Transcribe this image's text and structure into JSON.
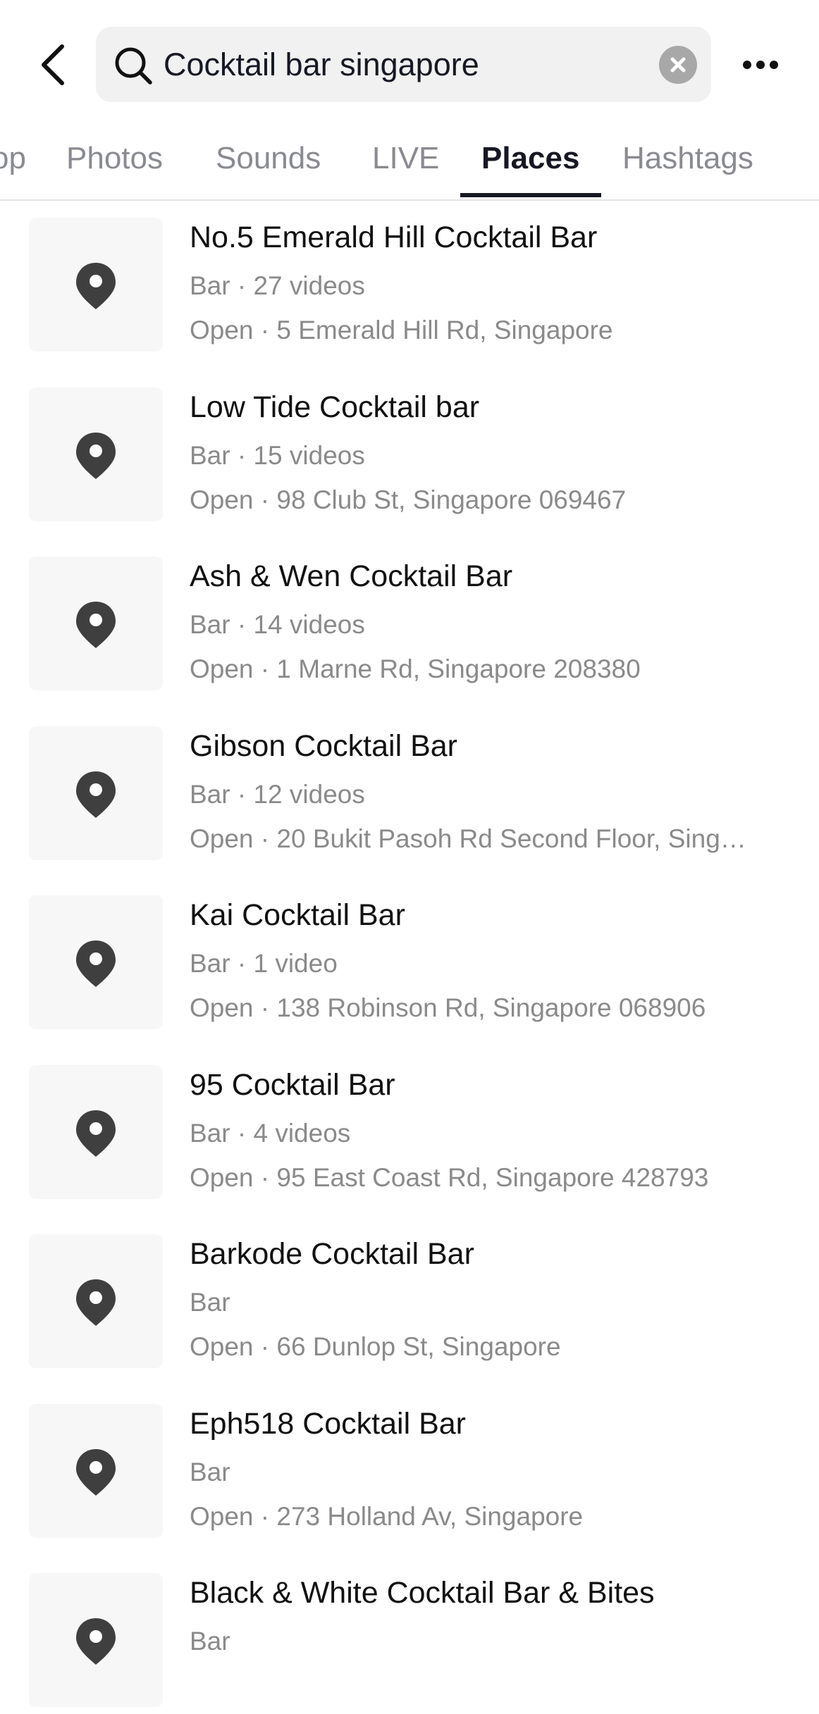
{
  "search": {
    "query": "Cocktail bar singapore",
    "icon": "search-icon"
  },
  "tabs": [
    {
      "label": "op",
      "active": false
    },
    {
      "label": "Photos",
      "active": false
    },
    {
      "label": "Sounds",
      "active": false
    },
    {
      "label": "LIVE",
      "active": false
    },
    {
      "label": "Places",
      "active": true
    },
    {
      "label": "Hashtags",
      "active": false
    }
  ],
  "places": [
    {
      "name": "No.5 Emerald Hill Cocktail Bar",
      "meta": "Bar · 27 videos",
      "address": "Open · 5 Emerald Hill Rd, Singapore"
    },
    {
      "name": "Low Tide Cocktail bar",
      "meta": "Bar · 15 videos",
      "address": "Open · 98 Club St, Singapore 069467"
    },
    {
      "name": "Ash & Wen Cocktail Bar",
      "meta": "Bar · 14 videos",
      "address": "Open · 1 Marne Rd, Singapore 208380"
    },
    {
      "name": "Gibson Cocktail Bar",
      "meta": "Bar · 12 videos",
      "address": "Open · 20 Bukit Pasoh Rd Second Floor, Sing…"
    },
    {
      "name": "Kai Cocktail Bar",
      "meta": "Bar · 1 video",
      "address": "Open · 138 Robinson Rd, Singapore 068906"
    },
    {
      "name": "95 Cocktail Bar",
      "meta": "Bar · 4 videos",
      "address": "Open · 95 East Coast Rd, Singapore 428793"
    },
    {
      "name": "Barkode Cocktail Bar",
      "meta": "Bar",
      "address": "Open · 66 Dunlop St, Singapore"
    },
    {
      "name": "Eph518 Cocktail Bar",
      "meta": "Bar",
      "address": "Open · 273 Holland Av, Singapore"
    },
    {
      "name": "Black & White Cocktail Bar & Bites",
      "meta": "Bar",
      "address": ""
    }
  ],
  "colors": {
    "pin": "#3f3f3f",
    "thumb_bg": "#f7f7f7",
    "search_bg": "#f1f1f2",
    "muted": "#8a8a8a"
  }
}
